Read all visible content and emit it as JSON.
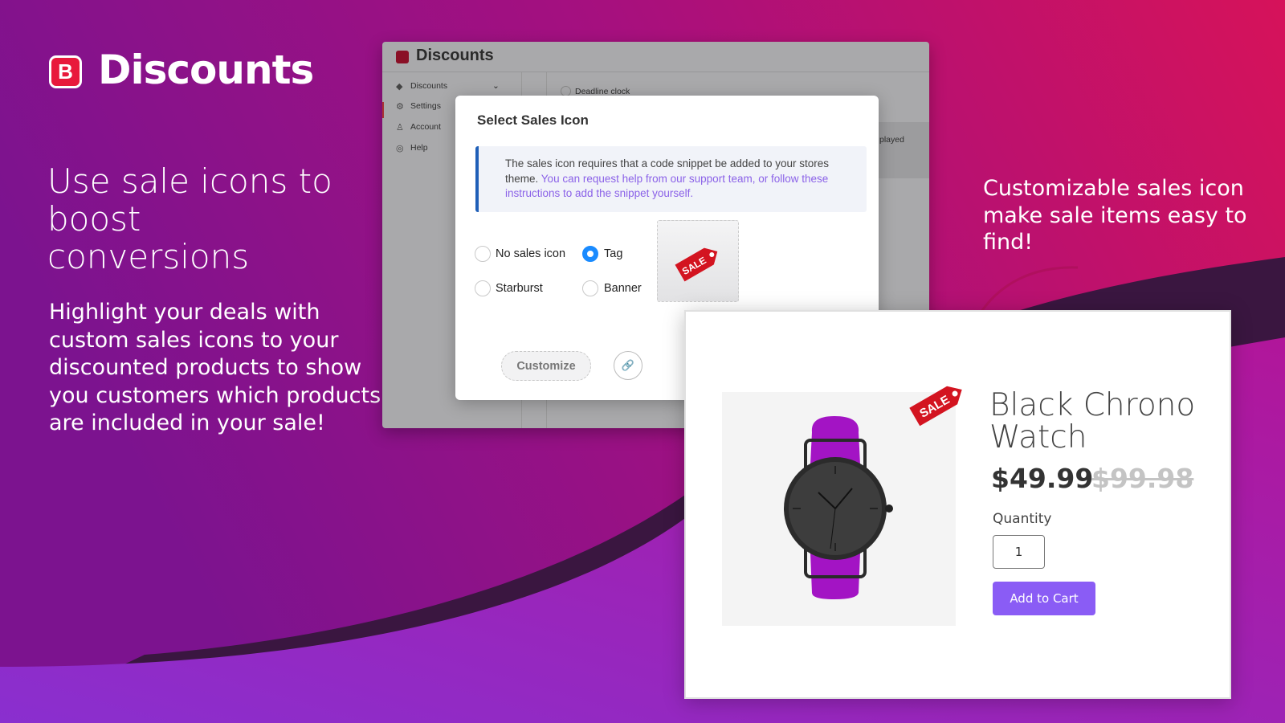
{
  "brand": {
    "logo_letter": "B",
    "name": "Discounts"
  },
  "headline": "Use sale icons to boost conversions",
  "description": "Highlight your deals with custom sales icons to your discounted products to show you customers which products are included in your sale!",
  "callout": "Customizable sales icon make sale items easy to find!",
  "colors": {
    "background_left": "#8e1598",
    "background_right": "#d4105a",
    "accent": "#8a5cf5",
    "selected_radio": "#1a8bff",
    "sale_tag": "#d31420"
  },
  "admin": {
    "title": "Discounts",
    "sidebar": [
      {
        "label": "Discounts",
        "icon": "tag-icon"
      },
      {
        "label": "Settings",
        "icon": "gear-icon"
      },
      {
        "label": "Account",
        "icon": "user-icon"
      },
      {
        "label": "Help",
        "icon": "help-icon"
      }
    ],
    "background_option": "Deadline clock",
    "partial_text": "played"
  },
  "modal": {
    "title": "Select Sales Icon",
    "info_text": "The sales icon requires that a code snippet be added to your stores theme.",
    "info_link": "You can request help from our support team, or follow these instructions to add the snippet yourself.",
    "options": [
      {
        "label": "No sales icon",
        "selected": false
      },
      {
        "label": "Tag",
        "selected": true
      },
      {
        "label": "Starburst",
        "selected": false
      },
      {
        "label": "Banner",
        "selected": false
      }
    ],
    "sale_tag_text": "SALE",
    "customize_label": "Customize"
  },
  "product": {
    "title": "Black Chrono Watch",
    "sale_tag_text": "SALE",
    "price": "$49.99",
    "original_price": "$99.98",
    "quantity_label": "Quantity",
    "quantity": "1",
    "add_to_cart": "Add to Cart"
  }
}
